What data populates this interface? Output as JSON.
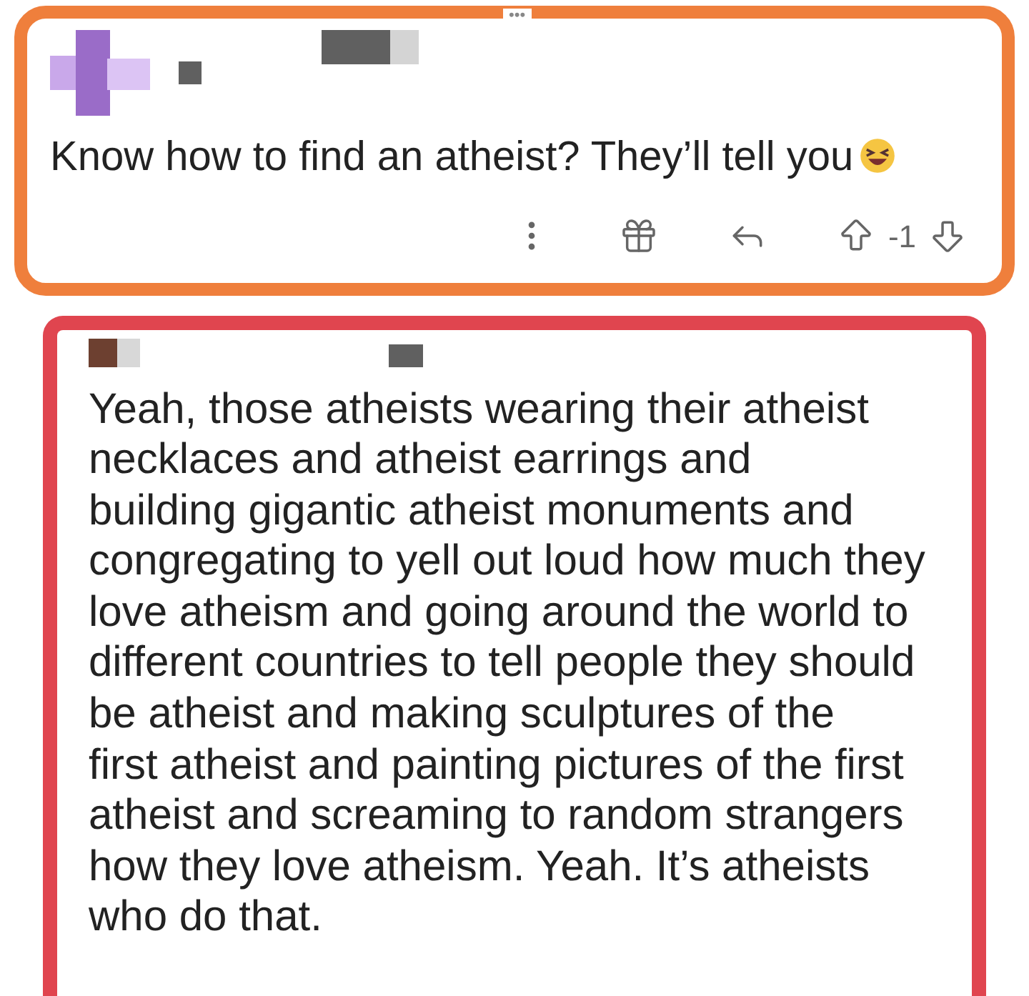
{
  "top_mark": "•••",
  "comments": [
    {
      "kind": "post",
      "color": "#ef7f3c",
      "text": "Know how to find an atheist? They’ll tell you",
      "has_emoji": true,
      "score": "-1"
    },
    {
      "kind": "reply",
      "color": "#e0454f",
      "text": "Yeah, those atheists wearing their atheist\nnecklaces and atheist earrings and\nbuilding gigantic atheist monuments and\ncongregating to yell out loud how much they\nlove atheism and going around the world to\ndifferent countries to tell people they should\nbe atheist and making sculptures of the\nfirst atheist and painting pictures of the first\natheist and screaming to random strangers\nhow they love atheism. Yeah. It’s atheists\nwho do that.",
      "has_emoji": false
    }
  ]
}
